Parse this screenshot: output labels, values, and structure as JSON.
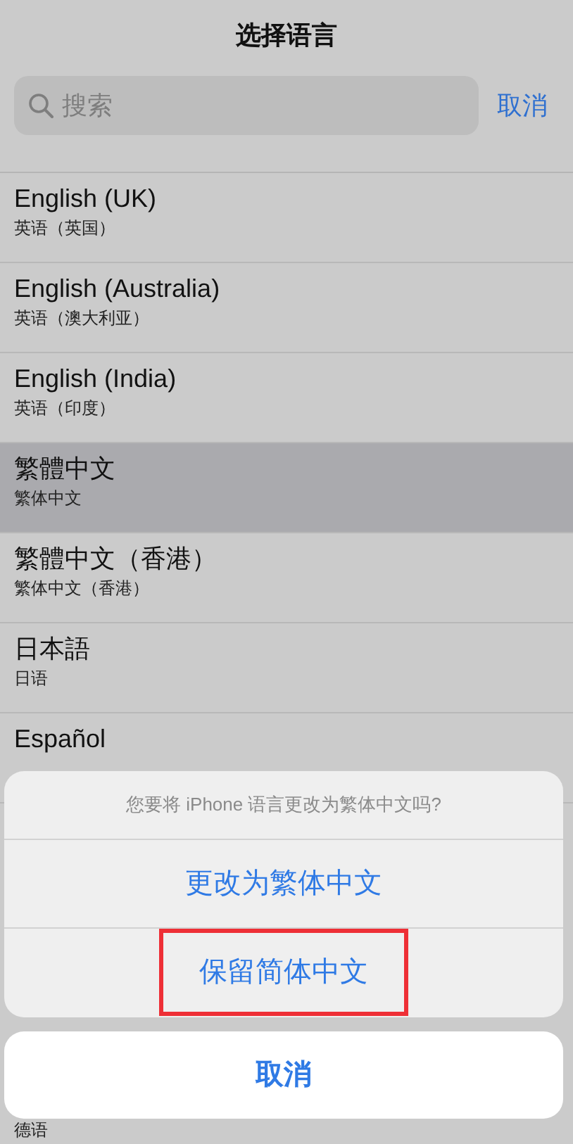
{
  "title": "选择语言",
  "search": {
    "placeholder": "搜索",
    "cancel": "取消"
  },
  "languages": [
    {
      "name": "English (UK)",
      "subtitle": "英语（英国）",
      "selected": false
    },
    {
      "name": "English (Australia)",
      "subtitle": "英语（澳大利亚）",
      "selected": false
    },
    {
      "name": "English (India)",
      "subtitle": "英语（印度）",
      "selected": false
    },
    {
      "name": "繁體中文",
      "subtitle": "繁体中文",
      "selected": true
    },
    {
      "name": "繁體中文（香港）",
      "subtitle": "繁体中文（香港）",
      "selected": false
    },
    {
      "name": "日本語",
      "subtitle": "日语",
      "selected": false
    },
    {
      "name": "Español",
      "selected": false
    },
    {
      "subtitle": "德语",
      "selected": false
    }
  ],
  "alert": {
    "message": "您要将 iPhone 语言更改为繁体中文吗?",
    "actions": [
      {
        "label": "更改为繁体中文",
        "highlighted": false
      },
      {
        "label": "保留简体中文",
        "highlighted": true
      }
    ],
    "cancel": "取消"
  }
}
